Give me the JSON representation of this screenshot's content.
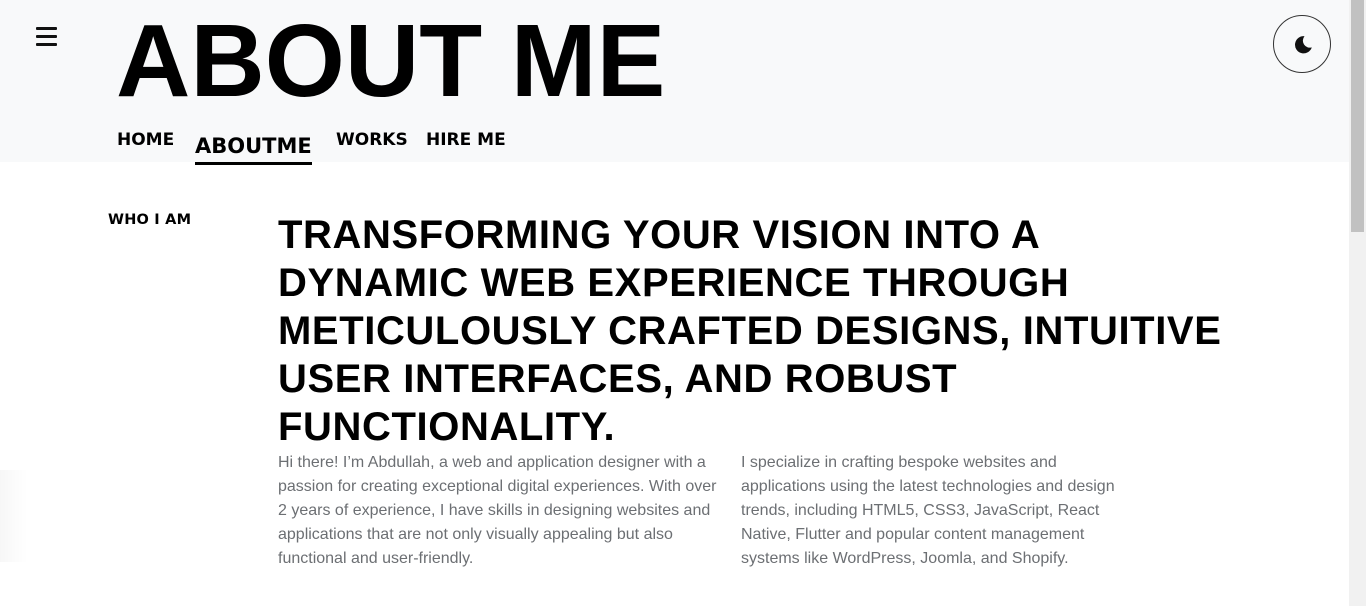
{
  "header": {
    "title": "ABOUT ME",
    "menu_icon": "hamburger-menu-icon",
    "theme_icon": "moon-icon"
  },
  "nav": {
    "items": [
      {
        "label": "HOME"
      },
      {
        "label": "ABOUTME",
        "active": true
      },
      {
        "label": "WORKS"
      },
      {
        "label": "HIRE ME"
      }
    ]
  },
  "main": {
    "section_label": "WHO I AM",
    "headline": "TRANSFORMING YOUR VISION INTO A DYNAMIC WEB EXPERIENCE THROUGH METICULOUSLY CRAFTED DESIGNS, INTUITIVE USER INTERFACES, AND ROBUST FUNCTIONALITY.",
    "paragraphs": [
      "Hi there! I’m Abdullah, a web and application designer with a passion for creating exceptional digital experiences. With over 2 years of experience, I have skills in designing websites and applications that are not only visually appealing but also functional and user-friendly.",
      "I specialize in crafting bespoke websites and applications using the latest technologies and design trends, including HTML5, CSS3, JavaScript, React Native, Flutter and popular content management systems like WordPress, Joomla, and Shopify."
    ]
  },
  "colors": {
    "header_bg": "#f8f9fa",
    "body_text": "#6c6f73",
    "heading": "#000000"
  }
}
